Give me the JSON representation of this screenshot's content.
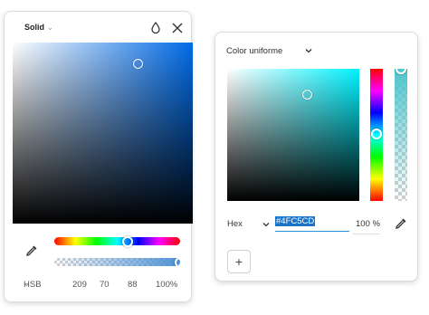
{
  "left_panel": {
    "mode": "Solid",
    "color_model": "HSB",
    "values": {
      "h": "209",
      "s": "70",
      "b": "88",
      "alpha": "100%"
    },
    "hue_fraction": 0.58,
    "alpha_fraction": 1.0,
    "sv_point": {
      "saturation": 0.7,
      "brightness": 0.88
    },
    "icons": [
      "chevron-down-icon",
      "droplet-icon",
      "close-icon",
      "eyedropper-icon"
    ]
  },
  "right_panel": {
    "mode": "Color uniforme",
    "format": "Hex",
    "hex_value": "#4FC5CD",
    "opacity": "100 %",
    "hue_fraction": 0.49,
    "alpha_fraction": 0.0,
    "sv_point": {
      "saturation": 0.61,
      "brightness": 0.8
    },
    "add_label": "+",
    "icons": [
      "chevron-down-icon",
      "eyedropper-icon",
      "plus-icon"
    ]
  },
  "colors": {
    "left_hue": "#006be8",
    "right_hue": "#00f2ff",
    "selected_left": "#4a92d6",
    "selected_right": "#4FC5CD",
    "accent": "#1a73c8"
  }
}
